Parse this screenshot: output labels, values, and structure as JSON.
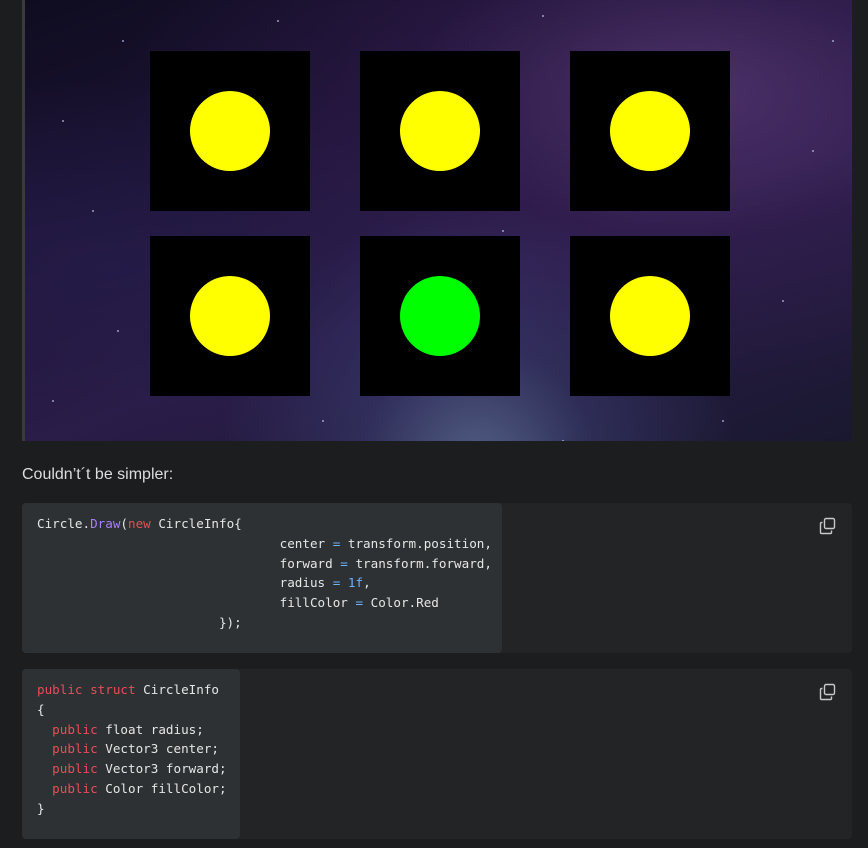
{
  "colors": {
    "page_bg": "#1c1d1f",
    "code_bg": "#2d3133",
    "keyword": "#e54e59",
    "method": "#a97eff",
    "operator": "#6cb4ff",
    "yellow_circle": "#ffff00",
    "green_circle": "#00ff00"
  },
  "image": {
    "tiles": [
      {
        "row": 1,
        "col": 1,
        "circle_color": "#ffff00"
      },
      {
        "row": 1,
        "col": 2,
        "circle_color": "#ffff00"
      },
      {
        "row": 1,
        "col": 3,
        "circle_color": "#ffff00"
      },
      {
        "row": 2,
        "col": 1,
        "circle_color": "#ffff00"
      },
      {
        "row": 2,
        "col": 2,
        "circle_color": "#00ff00"
      },
      {
        "row": 2,
        "col": 3,
        "circle_color": "#ffff00"
      }
    ]
  },
  "caption": "Couldn’t´t be simpler:",
  "code_block_1": {
    "copy_icon": "copy-icon",
    "lines": [
      [
        {
          "t": "Circle."
        },
        {
          "t": "Draw",
          "c": "fn"
        },
        {
          "t": "("
        },
        {
          "t": "new",
          "c": "kw"
        },
        {
          "t": " CircleInfo{"
        }
      ],
      [
        {
          "t": "                                center "
        },
        {
          "t": "=",
          "c": "op"
        },
        {
          "t": " transform.position,"
        }
      ],
      [
        {
          "t": "                                forward "
        },
        {
          "t": "=",
          "c": "op"
        },
        {
          "t": " transform.forward,"
        }
      ],
      [
        {
          "t": "                                radius "
        },
        {
          "t": "=",
          "c": "op"
        },
        {
          "t": " "
        },
        {
          "t": "1f",
          "c": "num"
        },
        {
          "t": ","
        }
      ],
      [
        {
          "t": "                                fillColor "
        },
        {
          "t": "=",
          "c": "op"
        },
        {
          "t": " Color.Red"
        }
      ],
      [
        {
          "t": "                        });"
        }
      ]
    ]
  },
  "code_block_2": {
    "copy_icon": "copy-icon",
    "lines": [
      [
        {
          "t": "public",
          "c": "kw"
        },
        {
          "t": " "
        },
        {
          "t": "struct",
          "c": "kw"
        },
        {
          "t": " CircleInfo"
        }
      ],
      [
        {
          "t": "{"
        }
      ],
      [
        {
          "t": "  "
        },
        {
          "t": "public",
          "c": "kw"
        },
        {
          "t": " float radius;"
        }
      ],
      [
        {
          "t": "  "
        },
        {
          "t": "public",
          "c": "kw"
        },
        {
          "t": " Vector3 center;"
        }
      ],
      [
        {
          "t": "  "
        },
        {
          "t": "public",
          "c": "kw"
        },
        {
          "t": " Vector3 forward;"
        }
      ],
      [
        {
          "t": "  "
        },
        {
          "t": "public",
          "c": "kw"
        },
        {
          "t": " Color fillColor;"
        }
      ],
      [
        {
          "t": "}"
        }
      ]
    ]
  }
}
